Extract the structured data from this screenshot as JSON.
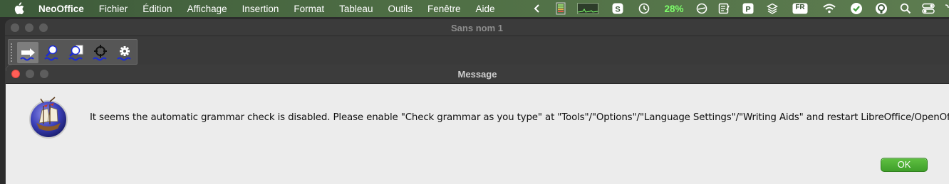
{
  "menubar": {
    "app_name": "NeoOffice",
    "items": [
      "Fichier",
      "Édition",
      "Affichage",
      "Insertion",
      "Format",
      "Tableau",
      "Outils",
      "Fenêtre",
      "Aide"
    ],
    "battery_percent": "28%",
    "input_source": "FR",
    "accent_battery": "#7dff6a"
  },
  "document_window": {
    "title": "Sans nom 1"
  },
  "toolbar": {
    "tools": [
      "arrow-right-icon",
      "magnifier-icon",
      "magnifier-document-icon",
      "target-icon",
      "gear-icon"
    ]
  },
  "dialog": {
    "title": "Message",
    "message": "It seems the automatic grammar check is disabled. Please enable \"Check grammar as you type\" at \"Tools\"/\"Options\"/\"Language Settings\"/\"Writing Aids\" and restart LibreOffice/OpenOffice.",
    "ok_label": "OK",
    "ok_color": "#4caf34"
  }
}
